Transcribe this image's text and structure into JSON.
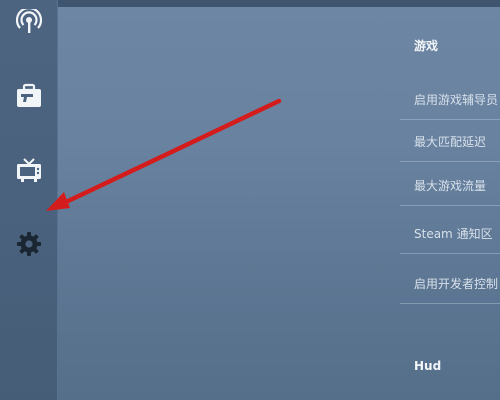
{
  "icons": {
    "nav_top": "antenna-icon",
    "nav_loadout": "briefcase-gun-icon",
    "nav_tv": "tv-icon",
    "nav_settings": "gear-icon",
    "annotation": "red-arrow"
  },
  "colors": {
    "annotation_arrow": "#d41c1c"
  },
  "settings": {
    "section_game": "游戏",
    "rows": [
      {
        "label": "启用游戏辅导员"
      },
      {
        "label": "最大匹配延迟"
      },
      {
        "label": "最大游戏流量"
      },
      {
        "label": "Steam 通知区"
      },
      {
        "label": "启用开发者控制"
      }
    ],
    "section_hud": "Hud"
  }
}
